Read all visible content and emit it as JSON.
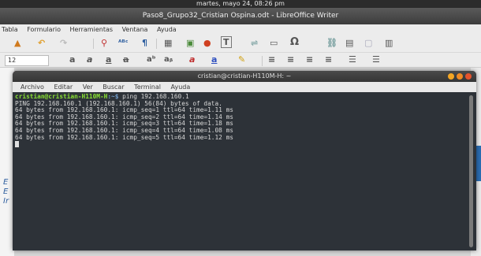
{
  "topbar": {
    "datetime": "martes, mayo 24, 08:26 pm"
  },
  "writer": {
    "title": "Paso8_Grupo32_Cristian Ospina.odt - LibreOffice Writer",
    "menu": [
      "Tabla",
      "Formulario",
      "Herramientas",
      "Ventana",
      "Ayuda"
    ],
    "font_size": "12"
  },
  "terminal": {
    "title": "cristian@cristian-H110M-H: ~",
    "menu": [
      "Archivo",
      "Editar",
      "Ver",
      "Buscar",
      "Terminal",
      "Ayuda"
    ],
    "prompt_user": "cristian@cristian-H110M-H",
    "prompt_path": ":~$",
    "command": " ping 192.168.160.1",
    "output": [
      "PING 192.168.160.1 (192.168.160.1) 56(84) bytes of data.",
      "64 bytes from 192.168.160.1: icmp_seq=1 ttl=64 time=1.11 ms",
      "64 bytes from 192.168.160.1: icmp_seq=2 ttl=64 time=1.14 ms",
      "64 bytes from 192.168.160.1: icmp_seq=3 ttl=64 time=1.18 ms",
      "64 bytes from 192.168.160.1: icmp_seq=4 ttl=64 time=1.08 ms",
      "64 bytes from 192.168.160.1: icmp_seq=5 ttl=64 time=1.12 ms"
    ]
  }
}
